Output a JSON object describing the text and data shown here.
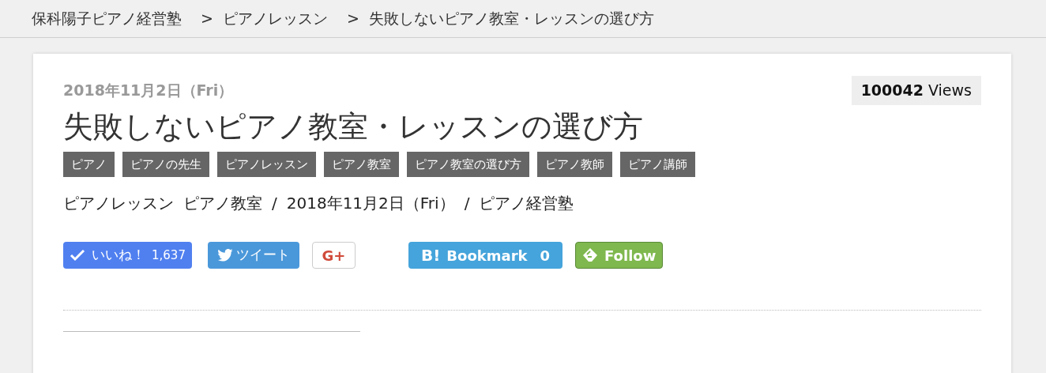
{
  "breadcrumb": {
    "items": [
      "保科陽子ピアノ経営塾",
      "ピアノレッスン",
      "失敗しないピアノ教室・レッスンの選び方"
    ],
    "separator": ">"
  },
  "article": {
    "date": "2018年11月2日（Fri）",
    "views": "**100042** Views",
    "title": "失敗しないピアノ教室・レッスンの選び方",
    "tags": [
      "ピアノ",
      "ピアノの先生",
      "ピアノレッスン",
      "ピアノ教室",
      "ピアノ教室の選び方",
      "ピアノ教師",
      "ピアノ講師"
    ],
    "meta": {
      "categories": [
        "ピアノレッスン",
        "ピアノ教室"
      ],
      "separator": "/",
      "date": "2018年11月2日（Fri）",
      "author": "ピアノ経営塾"
    },
    "share_buttons": [
      {
        "kind": "like",
        "label": "いいね！",
        "count": "1,637"
      },
      {
        "kind": "tweet",
        "label": "ツイート"
      },
      {
        "kind": "gplus",
        "label": "G+"
      },
      {
        "kind": "hatena",
        "label": "B!",
        "text": "Bookmark",
        "count": "0"
      },
      {
        "kind": "feedly",
        "label": "Follow"
      }
    ]
  }
}
